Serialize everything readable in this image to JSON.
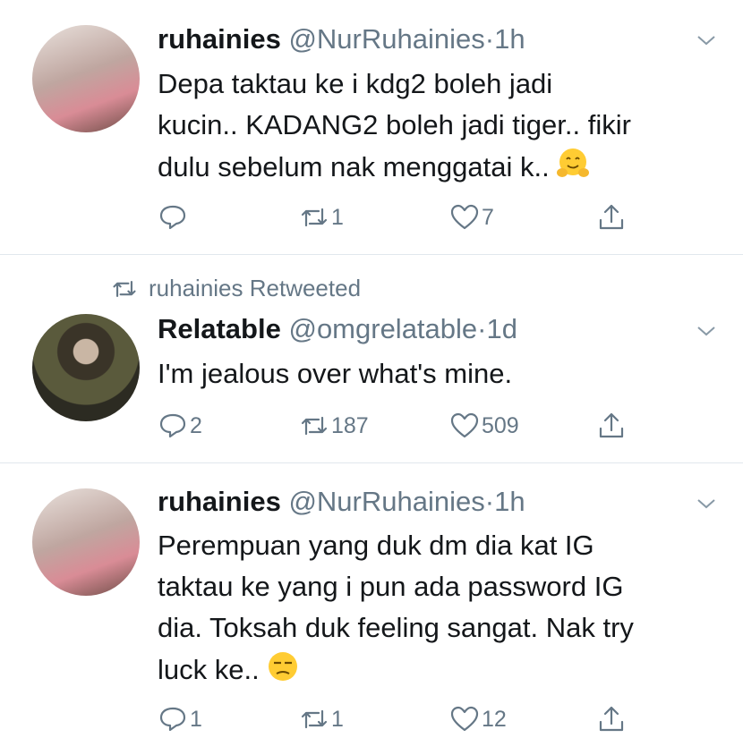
{
  "tweets": [
    {
      "name": "ruhainies",
      "handle": "@NurRuhainies",
      "separator": "·",
      "time": "1h",
      "lines": [
        "Depa taktau ke i kdg2 boleh jadi",
        "kucin.. KADANG2 boleh jadi tiger.. fikir",
        "dulu sebelum nak menggatai k.."
      ],
      "emoji": "hugging-face",
      "replies": "",
      "retweets": "1",
      "likes": "7"
    },
    {
      "retweet_banner": "ruhainies Retweeted",
      "name": "Relatable",
      "handle": "@omgrelatable",
      "separator": "·",
      "time": "1d",
      "lines": [
        "I'm jealous over what's mine."
      ],
      "replies": "2",
      "retweets": "187",
      "likes": "509"
    },
    {
      "name": "ruhainies",
      "handle": "@NurRuhainies",
      "separator": "·",
      "time": "1h",
      "lines": [
        "Perempuan yang duk dm dia kat IG",
        "taktau ke yang i pun ada password IG",
        "dia. Toksah duk feeling sangat. Nak try",
        "luck ke.."
      ],
      "emoji": "unamused-face",
      "replies": "1",
      "retweets": "1",
      "likes": "12"
    }
  ],
  "colors": {
    "text": "#14171a",
    "secondary": "#657786",
    "divider": "#e1e8ed",
    "emoji": "#ffcc33"
  }
}
